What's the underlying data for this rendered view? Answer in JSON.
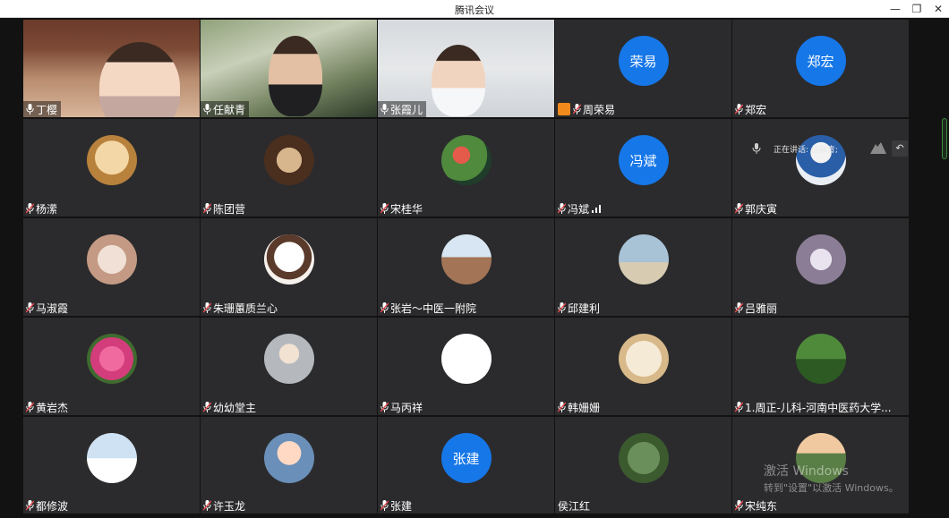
{
  "window": {
    "title": "腾讯会议",
    "min_label": "—",
    "restore_label": "❐",
    "close_label": "✕"
  },
  "speaking": {
    "text": "正在讲话: 任献青;"
  },
  "participants": [
    {
      "name": "丁樱",
      "type": "video"
    },
    {
      "name": "任献青",
      "type": "video"
    },
    {
      "name": "张霞儿",
      "type": "video"
    },
    {
      "name": "周荣易",
      "type": "text",
      "avatar_text": "荣易",
      "sharing": true
    },
    {
      "name": "郑宏",
      "type": "text",
      "avatar_text": "郑宏"
    },
    {
      "name": "杨潆",
      "type": "image"
    },
    {
      "name": "陈团营",
      "type": "image"
    },
    {
      "name": "宋桂华",
      "type": "image"
    },
    {
      "name": "冯斌",
      "type": "text",
      "avatar_text": "冯斌",
      "signal": true
    },
    {
      "name": "郭庆寅",
      "type": "image"
    },
    {
      "name": "马淑霞",
      "type": "image"
    },
    {
      "name": "朱珊蕙质兰心",
      "type": "image"
    },
    {
      "name": "张岩～中医一附院",
      "type": "image"
    },
    {
      "name": "邱建利",
      "type": "image"
    },
    {
      "name": "吕雅丽",
      "type": "image"
    },
    {
      "name": "黄岩杰",
      "type": "image"
    },
    {
      "name": "幼幼堂主",
      "type": "image"
    },
    {
      "name": "马丙祥",
      "type": "image"
    },
    {
      "name": "韩姗姗",
      "type": "image"
    },
    {
      "name": "1.周正-儿科-河南中医药大学...",
      "type": "image"
    },
    {
      "name": "都修波",
      "type": "image"
    },
    {
      "name": "许玉龙",
      "type": "image"
    },
    {
      "name": "张建",
      "type": "text",
      "avatar_text": "张建"
    },
    {
      "name": "侯江红",
      "type": "image",
      "no_mic": true
    },
    {
      "name": "宋纯东",
      "type": "image"
    }
  ],
  "watermark": {
    "line1": "激活 Windows",
    "line2": "转到\"设置\"以激活 Windows。"
  },
  "colors": {
    "avatar_blue": "#1677e8",
    "tile_bg": "#2b2b2d",
    "mic_red": "#e5484d"
  }
}
